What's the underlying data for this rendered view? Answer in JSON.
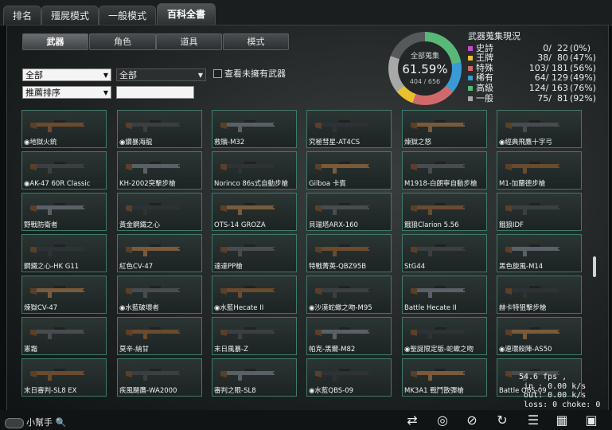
{
  "top_tabs": [
    "排名",
    "殭屍模式",
    "一般模式",
    "百科全書"
  ],
  "sub_tabs": [
    "武器",
    "角色",
    "道具",
    "模式"
  ],
  "filters": {
    "select1": "全部",
    "select2": "全部",
    "sort": "推薦排序",
    "search": "",
    "checkbox_label": "查看未擁有武器"
  },
  "collection": {
    "label": "全部蒐集",
    "percent": "61.59%",
    "count": "404 / 656"
  },
  "stats": {
    "title": "武器蒐集現況",
    "rows": [
      {
        "name": "史詩",
        "count": "0/  22",
        "pct": "(0%)",
        "color": "#c050c8"
      },
      {
        "name": "王牌",
        "count": "38/  80",
        "pct": "(47%)",
        "color": "#e8c030"
      },
      {
        "name": "特殊",
        "count": "103/ 181",
        "pct": "(56%)",
        "color": "#d06a6a"
      },
      {
        "name": "稀有",
        "count": "64/ 129",
        "pct": "(49%)",
        "color": "#3a9ad6"
      },
      {
        "name": "高級",
        "count": "124/ 163",
        "pct": "(76%)",
        "color": "#58b878"
      },
      {
        "name": "一般",
        "count": "75/  81",
        "pct": "(92%)",
        "color": "#a8a8a8"
      }
    ]
  },
  "weapons": [
    [
      "地獄火銃",
      "鑽暴海龍",
      "救贖-M32",
      "究極彗星-AT4CS",
      "煉獄之怒",
      "經典飛鷹十字弓"
    ],
    [
      "AK-47 60R Classic",
      "KH-2002突擊步槍",
      "Norinco 86s式自動步槍",
      "Gilboa 卡賓",
      "M1918-白朗寧自動步槍",
      "M1-加蘭德步槍"
    ],
    [
      "野戰防衛者",
      "黃金鋼鐵之心",
      "OTS-14 GROZA",
      "貝瑞塔ARX-160",
      "餓狼Clarion 5.56",
      "餓狼IDF"
    ],
    [
      "鋼鐵之心-HK G11",
      "紅色CV-47",
      "達達PP槍",
      "特戰菁英-QBZ95B",
      "StG44",
      "黑色旋風-M14"
    ],
    [
      "煉獄CV-47",
      "水藍破壞者",
      "水藍Hecate II",
      "沙漠蛇蠍之吻-M95",
      "Battle Hecate II",
      "赫卡特狙擊步槍"
    ],
    [
      "憲霜",
      "莫辛-納甘",
      "末日風暴-Z",
      "帕克-黑爾-M82",
      "聖誕限定版-蛇蠍之吻",
      "連環殺陣-AS50"
    ],
    [
      "末日審判-SL8 EX",
      "疾風颶鷹-WA2000",
      "審判之眼-SL8",
      "水藍QBS-09",
      "MK3A1 戰鬥散彈槍",
      "Battle QBS-09"
    ]
  ],
  "weapon_marks": [
    [
      true,
      true,
      false,
      false,
      false,
      true
    ],
    [
      true,
      false,
      false,
      false,
      false,
      false
    ],
    [
      false,
      false,
      false,
      false,
      false,
      false
    ],
    [
      false,
      false,
      false,
      false,
      false,
      false
    ],
    [
      false,
      true,
      true,
      true,
      false,
      false
    ],
    [
      false,
      false,
      false,
      false,
      true,
      true
    ],
    [
      false,
      false,
      false,
      true,
      false,
      false
    ]
  ],
  "helper_label": "小幫手",
  "fps_text": "54.6 fps ,\n in : 0.00 k/s\n out: 0.00 k/s\n loss: 0 choke: 0",
  "bottom_icons": [
    "switch-icon",
    "compass-icon",
    "runner-icon",
    "refresh-icon",
    "checklist-icon",
    "calendar-icon",
    "film-icon"
  ],
  "colors": {
    "accent_teal": "#3f7a68"
  }
}
